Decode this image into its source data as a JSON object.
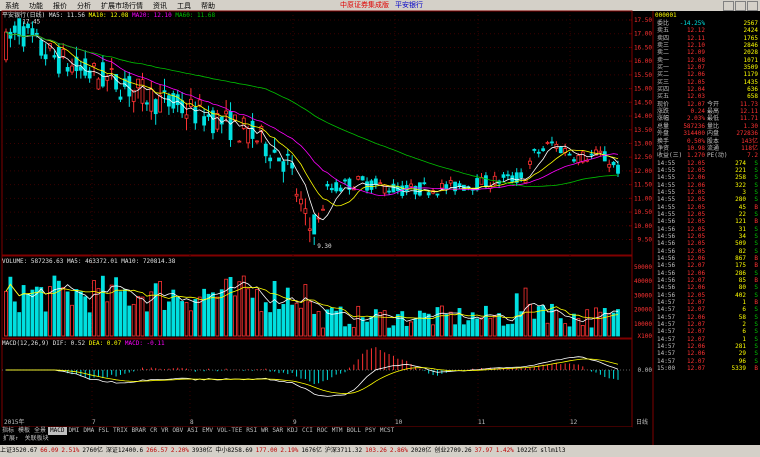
{
  "menu": [
    "系统",
    "功能",
    "报价",
    "分析",
    "扩展市场行情",
    "资讯",
    "工具",
    "帮助"
  ],
  "window_title": "中原证券集成版",
  "security_title": "平安银行",
  "kline_legend": {
    "name": "平安银行(日线)",
    "ma5": "MA5: 11.56",
    "ma10": "MA10: 12.08",
    "ma20": "MA20: 12.10",
    "ma60": "MA60: 11.68"
  },
  "volume_legend": "VOLUME: 587236.63 MA5: 463372.01 MA10: 720814.38",
  "macd_legend": {
    "label": "MACD(12,26,9)",
    "dif": "DIF: 0.52",
    "dea": "DEA: 0.07",
    "macd": "MACD: -0.11"
  },
  "price_axis": [
    "17.50",
    "17.00",
    "16.50",
    "16.00",
    "15.50",
    "15.00",
    "14.50",
    "14.00",
    "13.50",
    "13.00",
    "12.50",
    "12.00",
    "11.50",
    "11.00",
    "10.50",
    "10.00",
    "9.50"
  ],
  "volume_axis": [
    "50000",
    "40000",
    "30000",
    "20000",
    "10000",
    "X100"
  ],
  "macd_axis": [
    "0.00"
  ],
  "time_labels": [
    "2015年",
    "7",
    "8",
    "9",
    "10",
    "11",
    "12",
    "日线"
  ],
  "high_label": "17.45",
  "low_label": "9.30",
  "indicator_tabs": [
    "指标",
    "模板",
    "全景",
    "MACD",
    "DMI",
    "DMA",
    "FSL",
    "TRIX",
    "BRAR",
    "CR",
    "VR",
    "OBV",
    "ASI",
    "EMV",
    "VOL-TEE",
    "RSI",
    "WR",
    "SAR",
    "KDJ",
    "CCI",
    "ROC",
    "MTM",
    "BOLL",
    "PSY",
    "MCST"
  ],
  "sub_tabs": [
    "扩展↑",
    "关联板块"
  ],
  "quote_panel": {
    "code": "000001",
    "wei": {
      "label": "委比",
      "pct": "-14.25%",
      "diff": "2567"
    },
    "sell": [
      {
        "label": "卖五",
        "price": "12.12",
        "vol": "2424"
      },
      {
        "label": "卖四",
        "price": "12.11",
        "vol": "1765"
      },
      {
        "label": "卖三",
        "price": "12.10",
        "vol": "2846"
      },
      {
        "label": "卖二",
        "price": "12.09",
        "vol": "2028"
      },
      {
        "label": "卖一",
        "price": "12.08",
        "vol": "1071"
      }
    ],
    "buy": [
      {
        "label": "买一",
        "price": "12.07",
        "vol": "3509"
      },
      {
        "label": "买二",
        "price": "12.06",
        "vol": "1179"
      },
      {
        "label": "买三",
        "price": "12.05",
        "vol": "1435"
      },
      {
        "label": "买四",
        "price": "12.04",
        "vol": "636"
      },
      {
        "label": "买五",
        "price": "12.03",
        "vol": "658"
      }
    ],
    "stats": [
      {
        "l1": "现价",
        "v1": "12.07",
        "l2": "今开",
        "v2": "11.73"
      },
      {
        "l1": "涨跌",
        "v1": "0.24",
        "l2": "最高",
        "v2": "12.11"
      },
      {
        "l1": "涨幅",
        "v1": "2.03%",
        "l2": "最低",
        "v2": "11.71"
      },
      {
        "l1": "总量",
        "v1": "587236",
        "l2": "量比",
        "v2": "1.30"
      },
      {
        "l1": "外盘",
        "v1": "314400",
        "l2": "内盘",
        "v2": "272836"
      },
      {
        "l1": "换手",
        "v1": "0.50%",
        "l2": "股本",
        "v2": "143亿"
      },
      {
        "l1": "净资",
        "v1": "10.98",
        "l2": "流通",
        "v2": "118亿"
      },
      {
        "l1": "收益(三)",
        "v1": "1.270",
        "l2": "PE(动)",
        "v2": "7.2"
      }
    ],
    "ticks": [
      {
        "t": "14:55",
        "p": "12.05",
        "v": "274",
        "d": "S"
      },
      {
        "t": "14:55",
        "p": "12.05",
        "v": "221",
        "d": "S"
      },
      {
        "t": "14:55",
        "p": "12.06",
        "v": "258",
        "d": "S"
      },
      {
        "t": "14:55",
        "p": "12.06",
        "v": "322",
        "d": "S"
      },
      {
        "t": "14:55",
        "p": "12.05",
        "v": "3",
        "d": "S"
      },
      {
        "t": "14:55",
        "p": "12.05",
        "v": "280",
        "d": "S"
      },
      {
        "t": "14:55",
        "p": "12.05",
        "v": "45",
        "d": "B"
      },
      {
        "t": "14:55",
        "p": "12.05",
        "v": "22",
        "d": "S"
      },
      {
        "t": "14:56",
        "p": "12.05",
        "v": "121",
        "d": "B"
      },
      {
        "t": "14:56",
        "p": "12.05",
        "v": "31",
        "d": "S"
      },
      {
        "t": "14:56",
        "p": "12.05",
        "v": "34",
        "d": "S"
      },
      {
        "t": "14:56",
        "p": "12.05",
        "v": "509",
        "d": "S"
      },
      {
        "t": "14:56",
        "p": "12.05",
        "v": "82",
        "d": "S"
      },
      {
        "t": "14:56",
        "p": "12.06",
        "v": "867",
        "d": "B"
      },
      {
        "t": "14:56",
        "p": "12.07",
        "v": "175",
        "d": "B"
      },
      {
        "t": "14:56",
        "p": "12.06",
        "v": "286",
        "d": "S"
      },
      {
        "t": "14:56",
        "p": "12.07",
        "v": "85",
        "d": "B"
      },
      {
        "t": "14:56",
        "p": "12.06",
        "v": "80",
        "d": "S"
      },
      {
        "t": "14:56",
        "p": "12.05",
        "v": "402",
        "d": "S"
      },
      {
        "t": "14:57",
        "p": "12.07",
        "v": "1",
        "d": "B"
      },
      {
        "t": "14:57",
        "p": "12.07",
        "v": "6",
        "d": "S"
      },
      {
        "t": "14:57",
        "p": "12.06",
        "v": "58",
        "d": "S"
      },
      {
        "t": "14:57",
        "p": "12.07",
        "v": "2",
        "d": "S"
      },
      {
        "t": "14:57",
        "p": "12.07",
        "v": "6",
        "d": "S"
      },
      {
        "t": "14:57",
        "p": "12.07",
        "v": "1",
        "d": "S"
      },
      {
        "t": "14:57",
        "p": "12.06",
        "v": "281",
        "d": "S"
      },
      {
        "t": "14:57",
        "p": "12.06",
        "v": "29",
        "d": "S"
      },
      {
        "t": "14:57",
        "p": "12.07",
        "v": "96",
        "d": "S"
      },
      {
        "t": "15:00",
        "p": "12.07",
        "v": "5339",
        "d": "B"
      }
    ]
  },
  "status_bar": [
    {
      "text": "上证3520.67",
      "cls": "wh"
    },
    {
      "text": "66.09",
      "cls": "up"
    },
    {
      "text": "2.51%",
      "cls": "up"
    },
    {
      "text": "2760亿",
      "cls": "wh"
    },
    {
      "text": "深证12400.6",
      "cls": "wh"
    },
    {
      "text": "266.57",
      "cls": "up"
    },
    {
      "text": "2.20%",
      "cls": "up"
    },
    {
      "text": "3930亿",
      "cls": "wh"
    },
    {
      "text": "中小8258.69",
      "cls": "wh"
    },
    {
      "text": "177.00",
      "cls": "up"
    },
    {
      "text": "2.19%",
      "cls": "up"
    },
    {
      "text": "1676亿",
      "cls": "wh"
    },
    {
      "text": "沪深3711.32",
      "cls": "wh"
    },
    {
      "text": "103.26",
      "cls": "up"
    },
    {
      "text": "2.86%",
      "cls": "up"
    },
    {
      "text": "2020亿",
      "cls": "wh"
    },
    {
      "text": "创业2709.26",
      "cls": "wh"
    },
    {
      "text": "37.97",
      "cls": "up"
    },
    {
      "text": "1.42%",
      "cls": "up"
    },
    {
      "text": "1022亿",
      "cls": "wh"
    },
    {
      "text": "sllm1l3",
      "cls": "wh"
    }
  ],
  "colors": {
    "up": "#ff3232",
    "down": "#00e0e0",
    "ma5": "#ffffff",
    "ma10": "#ffff00",
    "ma20": "#ff00ff",
    "ma60": "#00c000",
    "grid": "#800000"
  },
  "chart_data": {
    "type": "candlestick",
    "ylim": [
      9.3,
      17.5
    ],
    "note_high": "17.45",
    "note_low": "9.30"
  }
}
